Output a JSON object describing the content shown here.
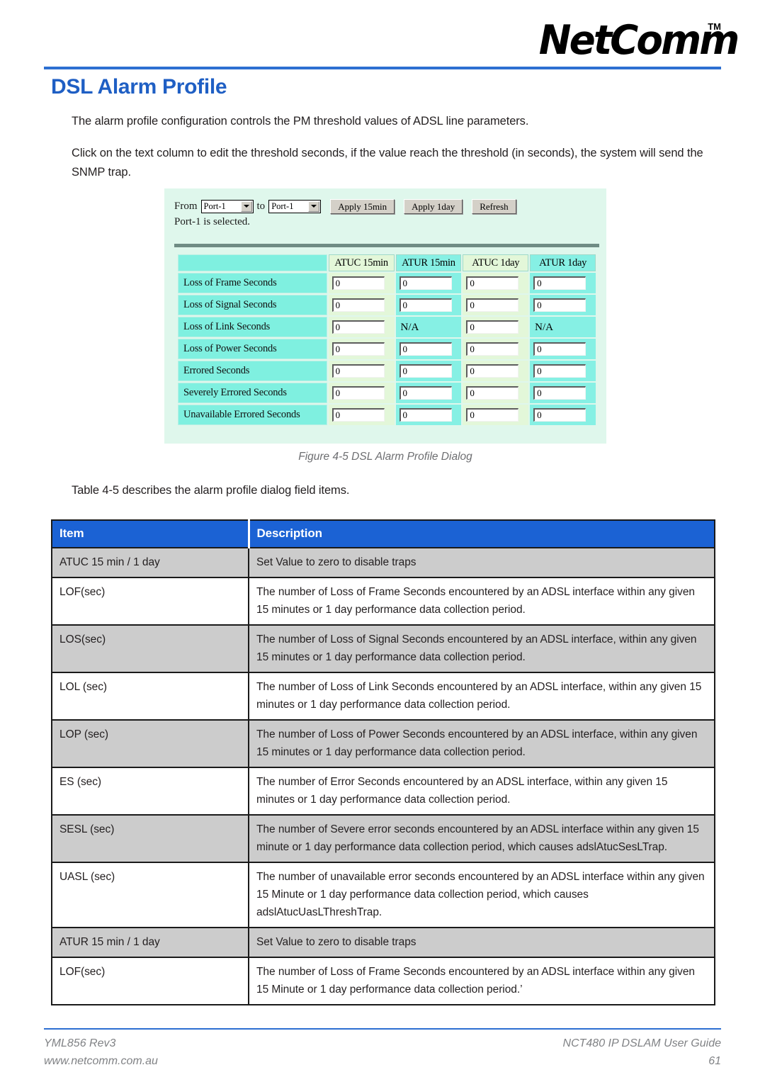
{
  "header": {
    "logo_text": "NetComm",
    "logo_tm": "TM"
  },
  "page_title": "DSL Alarm Profile",
  "paragraphs": {
    "intro": "The alarm profile configuration controls the PM threshold values of ADSL line parameters.",
    "instruction": "Click on the text column to edit the threshold seconds, if the value reach the threshold (in seconds), the system will send the SNMP trap."
  },
  "figure": {
    "caption": "Figure 4-5 DSL Alarm Profile Dialog",
    "dialog": {
      "from_label": "From",
      "from_value": "Port-1",
      "to_label": "to",
      "to_value": "Port-1",
      "buttons": [
        {
          "label": "Apply 15min",
          "name": "apply-15min-button"
        },
        {
          "label": "Apply 1day",
          "name": "apply-1day-button"
        },
        {
          "label": "Refresh",
          "name": "refresh-button"
        }
      ],
      "status": "Port-1 is selected.",
      "table": {
        "corner": "",
        "columns": [
          "ATUC 15min",
          "ATUR 15min",
          "ATUC 1day",
          "ATUR 1day"
        ],
        "rows": [
          {
            "label": "Loss of Frame Seconds",
            "values": [
              "0",
              "0",
              "0",
              "0"
            ]
          },
          {
            "label": "Loss of Signal Seconds",
            "values": [
              "0",
              "0",
              "0",
              "0"
            ]
          },
          {
            "label": "Loss of Link Seconds",
            "values": [
              "0",
              "N/A",
              "0",
              "N/A"
            ]
          },
          {
            "label": "Loss of Power Seconds",
            "values": [
              "0",
              "0",
              "0",
              "0"
            ]
          },
          {
            "label": "Errored Seconds",
            "values": [
              "0",
              "0",
              "0",
              "0"
            ]
          },
          {
            "label": "Severely Errored Seconds",
            "values": [
              "0",
              "0",
              "0",
              "0"
            ]
          },
          {
            "label": "Unavailable Errored Seconds",
            "values": [
              "0",
              "0",
              "0",
              "0"
            ]
          }
        ]
      }
    }
  },
  "table_intro": "Table 4-5 describes the alarm profile dialog field items.",
  "main_table": {
    "headers": {
      "item": "Item",
      "description": "Description"
    },
    "rows": [
      {
        "item": "ATUC 15 min / 1 day",
        "description": "Set Value to zero to disable traps",
        "shaded": true
      },
      {
        "item": "LOF(sec)",
        "description": "The number of Loss of Frame Seconds encountered by an ADSL interface within any given 15 minutes or 1 day performance data collection period.",
        "shaded": false
      },
      {
        "item": "LOS(sec)",
        "description": "The number of Loss of Signal Seconds encountered by an ADSL interface, within any given 15 minutes or 1 day performance data collection period.",
        "shaded": true
      },
      {
        "item": "LOL (sec)",
        "description": "The number of Loss of Link Seconds encountered by an ADSL interface, within any given 15 minutes or 1 day performance data collection period.",
        "shaded": false
      },
      {
        "item": "LOP (sec)",
        "description": "The number of Loss of Power Seconds encountered by an ADSL interface, within any given 15 minutes or 1 day performance data collection period.",
        "shaded": true
      },
      {
        "item": "ES (sec)",
        "description": "The number of Error Seconds encountered by an ADSL interface, within any given 15 minutes or 1 day performance data collection period.",
        "shaded": false
      },
      {
        "item": "SESL (sec)",
        "description": "The number of Severe error seconds encountered by an ADSL interface within any given 15 minute or 1 day performance data collection period, which causes adslAtucSesLTrap.",
        "shaded": true
      },
      {
        "item": "UASL (sec)",
        "description": "The number of unavailable error seconds encountered by an ADSL interface within any given 15 Minute or 1 day performance data collection period, which causes adslAtucUasLThreshTrap.",
        "shaded": false
      },
      {
        "item": "ATUR 15 min / 1 day",
        "description": "Set Value to zero to disable traps",
        "shaded": true
      },
      {
        "item": "LOF(sec)",
        "description": "The number of Loss of Frame Seconds encountered by an ADSL interface within any given 15 Minute or 1 day performance data collection period.’",
        "shaded": false
      }
    ]
  },
  "footer": {
    "left_line1": "YML856 Rev3",
    "left_line2": "www.netcomm.com.au",
    "right_line1": "NCT480 IP DSLAM User Guide",
    "right_line2": "61"
  },
  "colors": {
    "accent_blue": "#1b62d4",
    "title_blue": "#1f5fc4",
    "rule_blue": "#2d6fd1",
    "shade_gray": "#cccccc",
    "dialog_bg": "#dff7ec",
    "dialog_cyan": "#7ff0e0",
    "dialog_green": "#e3f7d9"
  }
}
